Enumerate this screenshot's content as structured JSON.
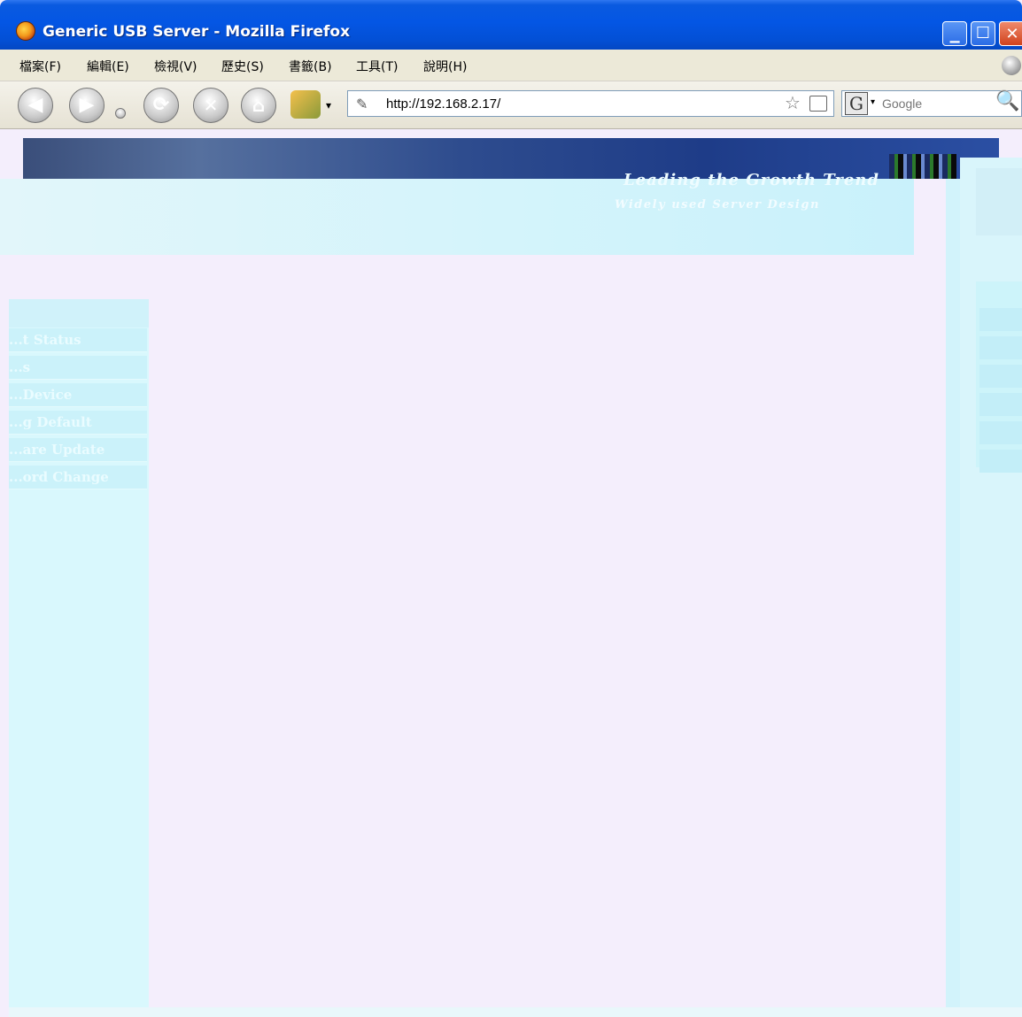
{
  "window": {
    "title": "Generic USB Server - Mozilla Firefox",
    "controls": {
      "minimize": "▁",
      "maximize": "☐",
      "close": "✕"
    }
  },
  "menubar": {
    "items": [
      {
        "label": "檔案(F)"
      },
      {
        "label": "編輯(E)"
      },
      {
        "label": "檢視(V)"
      },
      {
        "label": "歷史(S)"
      },
      {
        "label": "書籤(B)"
      },
      {
        "label": "工具(T)"
      },
      {
        "label": "說明(H)"
      }
    ]
  },
  "toolbar": {
    "back_icon": "◀",
    "forward_icon": "▶",
    "reload_icon": "⟳",
    "stop_icon": "✕",
    "home_icon": "⌂",
    "extension_caret": "▾",
    "url": "http://192.168.2.17/",
    "page_icon": "✎",
    "bookmark_star": "☆",
    "search_engine_icon": "G",
    "search_engine_caret": "▾",
    "search_placeholder": "Google",
    "search_icon": "🔍"
  },
  "page": {
    "banner_title": "Leading the Growth Trend",
    "banner_subtitle": "Widely used Server Design",
    "sidebar_items": [
      {
        "label": "...t Status"
      },
      {
        "label": "...s"
      },
      {
        "label": "...Device"
      },
      {
        "label": "...g Default"
      },
      {
        "label": "...are Update"
      },
      {
        "label": "...ord Change"
      }
    ]
  },
  "colors": {
    "titlebar_blue": "#0456e4",
    "menubar_bg": "#ece9d8",
    "page_bg": "#f4eefc",
    "sidebar_bg": "#d9f8fd",
    "banner_dark": "#1e3c88"
  }
}
